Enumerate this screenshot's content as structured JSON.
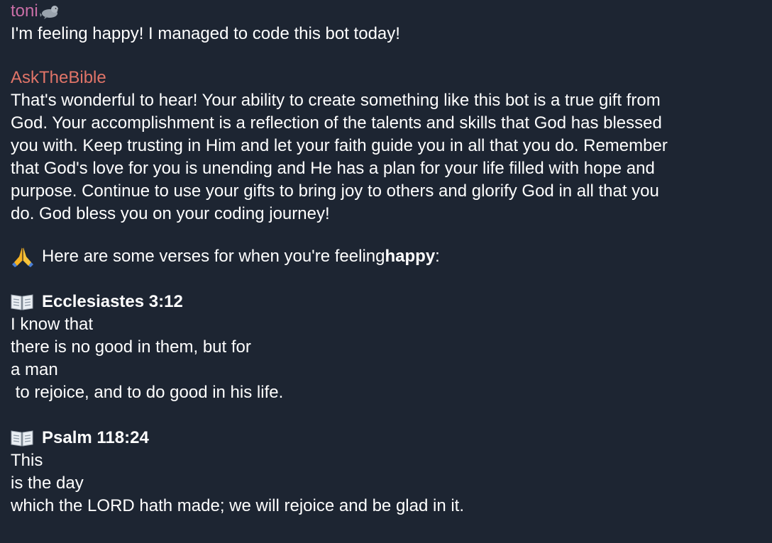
{
  "messages": {
    "user": {
      "sender": "toni",
      "sender_icon": "seal-emoji",
      "text": "I'm feeling happy! I managed to code this bot today!"
    },
    "bot": {
      "sender": "AskTheBible",
      "reply_lines": [
        "That's wonderful to hear! Your ability to create something like this bot is a true gift from",
        "God. Your accomplishment is a reflection of the talents and skills that God has blessed",
        "you with. Keep trusting in Him and let your faith guide you in all that you do. Remember",
        "that God's love for you is unending and He has a plan for your life filled with hope and",
        "purpose. Continue to use your gifts to bring joy to others and glorify God in all that you",
        "do. God bless you on your coding journey!"
      ],
      "intro": {
        "icon": "folded-hands-emoji",
        "prefix": "Here are some verses for when you're feeling ",
        "mood": "happy",
        "suffix": ":"
      },
      "verses": [
        {
          "icon": "open-book-emoji",
          "reference": "Ecclesiastes 3:12",
          "lines": [
            "I know that",
            "there is no good in them, but for",
            "a man",
            " to rejoice, and to do good in his life."
          ]
        },
        {
          "icon": "open-book-emoji",
          "reference": "Psalm 118:24",
          "lines": [
            "This",
            "is the day",
            "which the LORD hath made; we will rejoice and be glad in it."
          ]
        }
      ]
    }
  },
  "colors": {
    "background": "#1d2532",
    "user_name": "#c96ea6",
    "bot_name": "#e07468",
    "text": "#ffffff"
  }
}
